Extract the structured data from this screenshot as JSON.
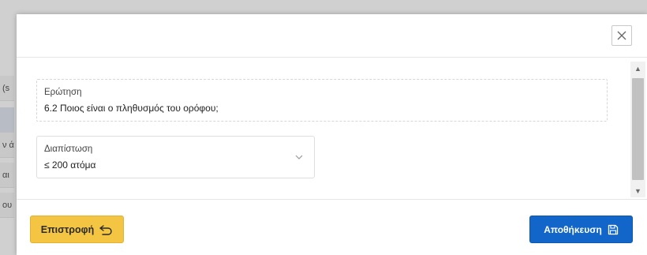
{
  "background": {
    "rows": [
      "(s",
      "ν ά",
      "αι",
      "ου"
    ]
  },
  "dialog": {
    "close_glyph": "✕",
    "question": {
      "label": "Ερώτηση",
      "value": "6.2 Ποιος είναι ο πληθυσμός του ορόφου;"
    },
    "finding": {
      "label": "Διαπίστωση",
      "selected": "≤ 200 ατόμα"
    },
    "footer": {
      "back_label": "Επιστροφή",
      "save_label": "Αποθήκευση"
    }
  },
  "colors": {
    "back_button": "#f4c542",
    "save_button": "#1266c9"
  },
  "icons": {
    "close": "close-icon",
    "chevron": "chevron-down-icon",
    "back": "return-arrow-icon",
    "save": "floppy-disk-icon"
  }
}
